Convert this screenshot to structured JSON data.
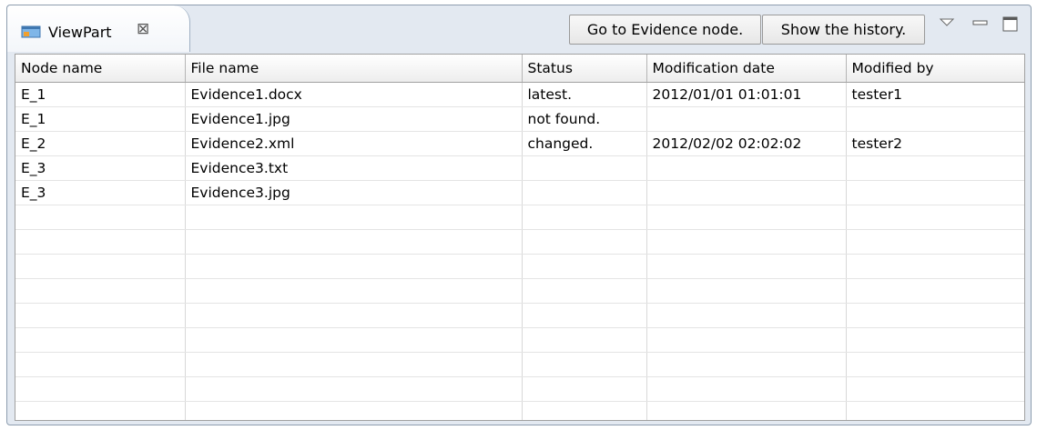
{
  "view": {
    "tab_label": "ViewPart",
    "tab_icon": "viewpart-icon",
    "close_icon": "close-icon",
    "go_button_label": "Go to Evidence node.",
    "history_button_label": "Show the history.",
    "menu_icon": "view-menu-icon",
    "minimize_icon": "minimize-icon",
    "maximize_icon": "maximize-icon"
  },
  "table": {
    "columns": [
      "Node name",
      "File name",
      "Status",
      "Modification date",
      "Modified by"
    ],
    "rows": [
      [
        "E_1",
        "Evidence1.docx",
        "latest.",
        "2012/01/01 01:01:01",
        "tester1"
      ],
      [
        "E_1",
        "Evidence1.jpg",
        "not found.",
        "",
        ""
      ],
      [
        "E_2",
        "Evidence2.xml",
        "changed.",
        "2012/02/02 02:02:02",
        "tester2"
      ],
      [
        "E_3",
        "Evidence3.txt",
        "",
        "",
        ""
      ],
      [
        "E_3",
        "Evidence3.jpg",
        "",
        "",
        ""
      ],
      [
        "",
        "",
        "",
        "",
        ""
      ],
      [
        "",
        "",
        "",
        "",
        ""
      ],
      [
        "",
        "",
        "",
        "",
        ""
      ],
      [
        "",
        "",
        "",
        "",
        ""
      ],
      [
        "",
        "",
        "",
        "",
        ""
      ],
      [
        "",
        "",
        "",
        "",
        ""
      ],
      [
        "",
        "",
        "",
        "",
        ""
      ],
      [
        "",
        "",
        "",
        "",
        ""
      ],
      [
        "",
        "",
        "",
        "",
        ""
      ]
    ]
  }
}
